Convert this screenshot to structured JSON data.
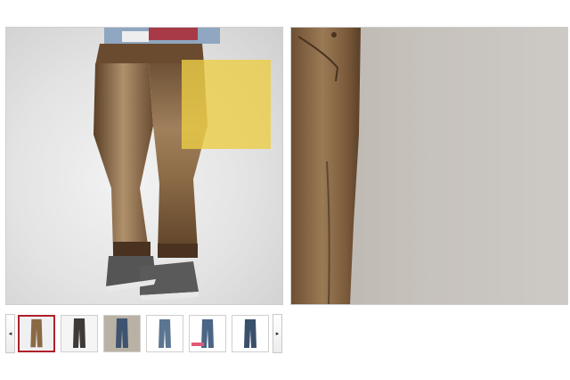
{
  "product_gallery": {
    "main_image": {
      "description_icon": "product-photo-brown-jeans"
    },
    "zoom_lens": {
      "color": "#ebcd46"
    },
    "zoom_view": {
      "description_icon": "zoomed-denim-detail"
    },
    "thumbnails": {
      "prev_arrow": "◂",
      "next_arrow": "▸",
      "selected_index": 0,
      "selected_border_color": "#b0202a",
      "items": [
        {
          "icon": "brown-jeans-thumbnail",
          "color": "#8a6a45"
        },
        {
          "icon": "dark-jeans-thumbnail",
          "color": "#3d3a38"
        },
        {
          "icon": "blue-jeans-thumbnail",
          "color": "#3e5370"
        },
        {
          "icon": "light-blue-jeans-thumbnail",
          "color": "#5b7691"
        },
        {
          "icon": "blue-jeans-label-thumbnail",
          "color": "#4a6585"
        },
        {
          "icon": "navy-jeans-thumbnail",
          "color": "#3a4f6a"
        }
      ]
    }
  }
}
